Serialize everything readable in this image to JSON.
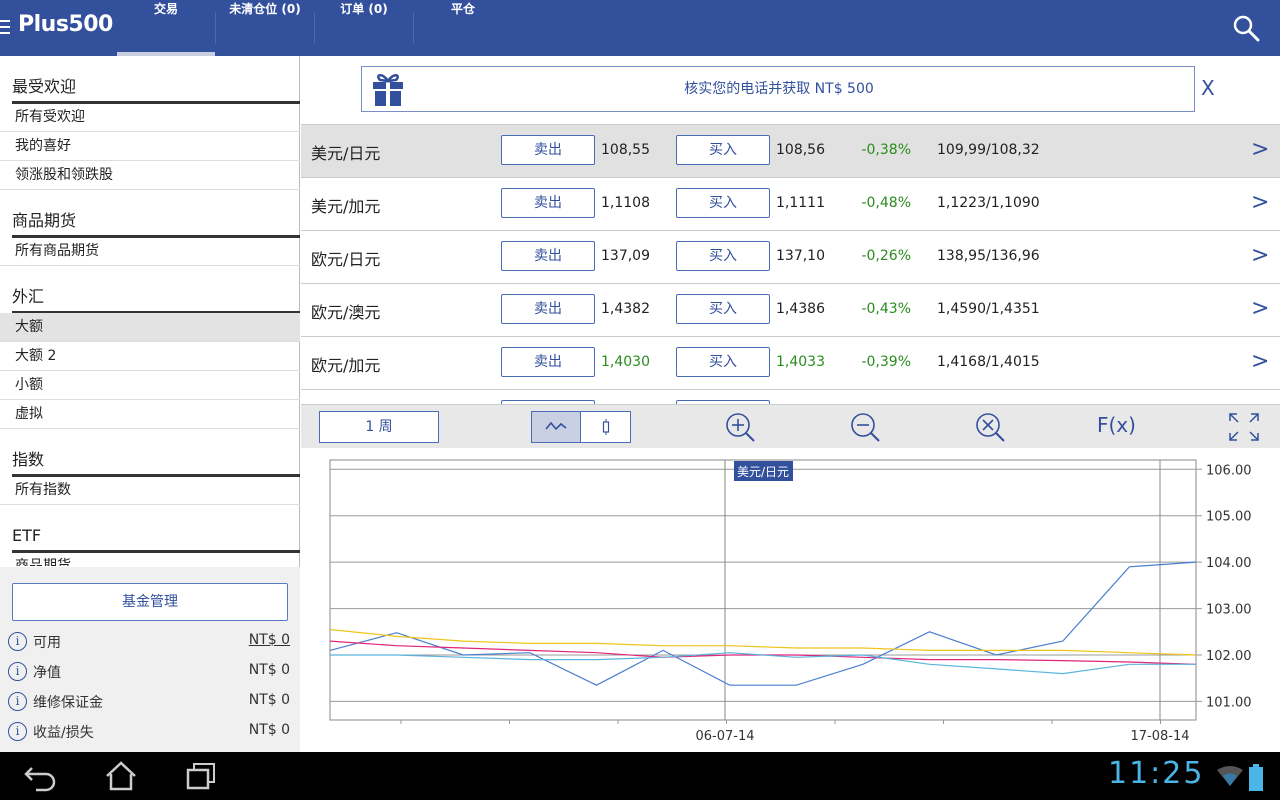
{
  "header": {
    "logo_text": "Plus500",
    "tabs": [
      {
        "label": "交易"
      },
      {
        "label": "未清仓位 (0)"
      },
      {
        "label": "订单 (0)"
      },
      {
        "label": "平仓"
      }
    ],
    "search_icon": "search-icon"
  },
  "sidebar": {
    "sections": [
      {
        "title": "最受欢迎",
        "items": [
          "所有受欢迎",
          "我的喜好",
          "领涨股和领跌股"
        ]
      },
      {
        "title": "商品期货",
        "items": [
          "所有商品期货"
        ]
      },
      {
        "title": "外汇",
        "items": [
          "大额",
          "大额 2",
          "小额",
          "虚拟"
        ],
        "selected": "大额"
      },
      {
        "title": "指数",
        "items": [
          "所有指数"
        ]
      },
      {
        "title": "ETF",
        "items": [
          "商品期货"
        ]
      }
    ],
    "fund_button": "基金管理",
    "account": [
      {
        "label": "可用",
        "value": "NT$ 0"
      },
      {
        "label": "净值",
        "value": "NT$ 0"
      },
      {
        "label": "维修保证金",
        "value": "NT$ 0"
      },
      {
        "label": "收益/损失",
        "value": "NT$ 0"
      }
    ]
  },
  "promo": {
    "text": "核实您的电话并获取 NT$ 500",
    "close": "X"
  },
  "quotes": {
    "sell_label": "卖出",
    "buy_label": "买入",
    "rows": [
      {
        "name": "美元/日元",
        "sell": "108,55",
        "buy": "108,56",
        "change": "-0,38%",
        "range": "109,99/108,32",
        "selected": true
      },
      {
        "name": "美元/加元",
        "sell": "1,1108",
        "buy": "1,1111",
        "change": "-0,48%",
        "range": "1,1223/1,1090"
      },
      {
        "name": "欧元/日元",
        "sell": "137,09",
        "buy": "137,10",
        "change": "-0,26%",
        "range": "138,95/136,96"
      },
      {
        "name": "欧元/澳元",
        "sell": "1,4382",
        "buy": "1,4386",
        "change": "-0,43%",
        "range": "1,4590/1,4351"
      },
      {
        "name": "欧元/加元",
        "sell": "1,4030",
        "buy": "1,4033",
        "change": "-0,39%",
        "range": "1,4168/1,4015",
        "green_prices": true
      }
    ]
  },
  "chart_toolbar": {
    "period": "1 周",
    "fx_label": "F(x)"
  },
  "chart_data": {
    "type": "line",
    "title": "美元/日元",
    "y_ticks": [
      "106.00",
      "105.00",
      "104.00",
      "103.00",
      "102.00",
      "101.00"
    ],
    "ylim": [
      100.6,
      106.2
    ],
    "x_tick_labels": [
      "06-07-14",
      "17-08-14"
    ],
    "x": [
      0,
      1,
      2,
      3,
      4,
      5,
      6,
      7,
      8,
      9,
      10,
      11,
      12,
      13,
      14,
      15,
      16,
      17
    ],
    "series": [
      {
        "color": "#4a7fcf",
        "values": [
          102.1,
          102.48,
          102.0,
          102.05,
          101.35,
          102.1,
          101.35,
          101.35,
          101.8,
          102.5,
          102.0,
          102.3,
          103.9,
          104.0
        ]
      },
      {
        "color": "#f0c419",
        "values": [
          102.55,
          102.4,
          102.3,
          102.25,
          102.25,
          102.2,
          102.2,
          102.15,
          102.15,
          102.1,
          102.1,
          102.1,
          102.05,
          102.0
        ]
      },
      {
        "color": "#e0247a",
        "values": [
          102.3,
          102.2,
          102.15,
          102.1,
          102.05,
          101.95,
          102.0,
          102.0,
          101.95,
          101.9,
          101.9,
          101.88,
          101.85,
          101.8
        ]
      },
      {
        "color": "#5ab4e0",
        "values": [
          102.0,
          102.0,
          101.95,
          101.9,
          101.9,
          101.95,
          102.05,
          101.95,
          102.0,
          101.8,
          101.7,
          101.6,
          101.8,
          101.8
        ]
      }
    ]
  },
  "system": {
    "clock": "11:25"
  }
}
